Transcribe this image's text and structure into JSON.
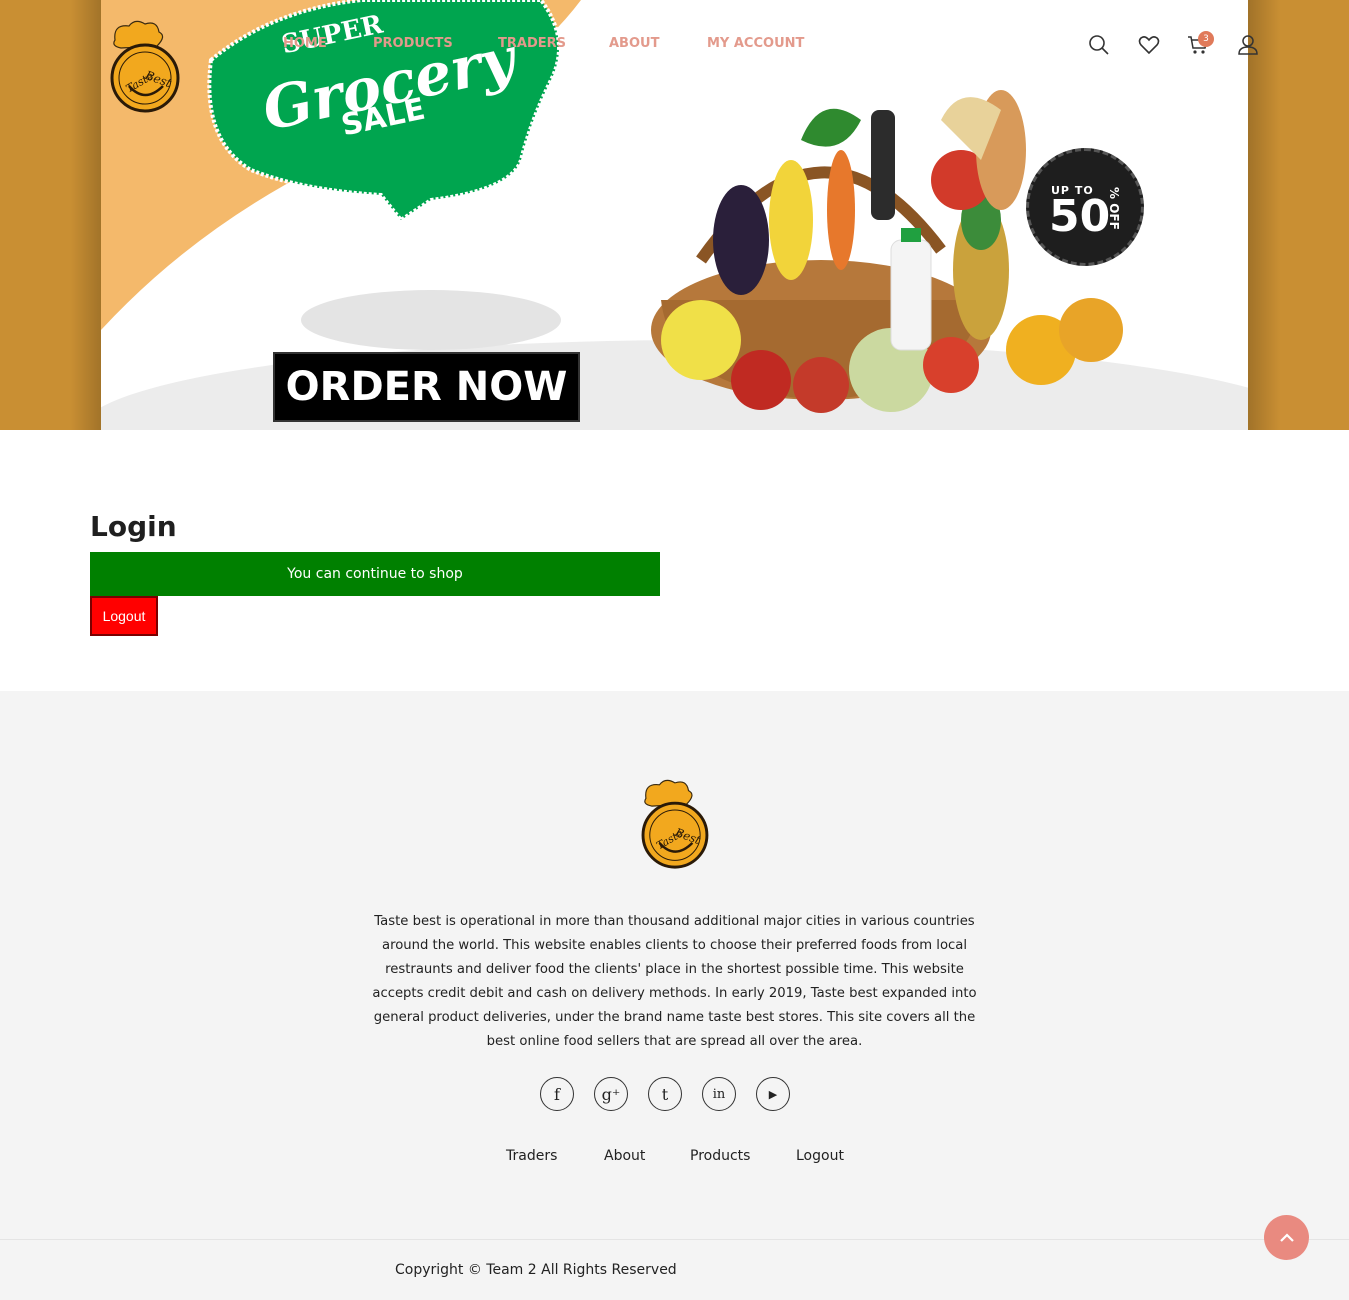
{
  "header": {
    "nav": [
      {
        "label": "HOME"
      },
      {
        "label": "PRODUCTS"
      },
      {
        "label": "TRADERS"
      },
      {
        "label": "ABOUT"
      },
      {
        "label": "MY ACCOUNT"
      }
    ],
    "cart_count": "3",
    "icons": [
      "search-icon",
      "heart-icon",
      "cart-icon",
      "user-icon"
    ]
  },
  "banner": {
    "line1": "SUPER",
    "line2": "Grocery",
    "line3": "SALE",
    "cta": "ORDER NOW",
    "badge_up_to": "UP TO",
    "badge_value": "50",
    "badge_unit": "% OFF"
  },
  "login": {
    "title": "Login",
    "message": "You can continue to shop",
    "logout_label": "Logout"
  },
  "footer": {
    "about": "Taste best is operational in more than thousand additional major cities in various countries around the world. This website enables clients to choose their preferred foods from local restraunts and deliver food the clients' place in the shortest possible time. This website accepts credit debit and cash on delivery methods. In early 2019, Taste best expanded into general product deliveries, under the brand name taste best stores. This site covers all the best online food sellers that are spread all over the area.",
    "socials": [
      {
        "icon": "facebook-icon",
        "glyph": "f"
      },
      {
        "icon": "google-plus-icon",
        "glyph": "g⁺"
      },
      {
        "icon": "tumblr-icon",
        "glyph": "t"
      },
      {
        "icon": "linkedin-icon",
        "glyph": "in"
      },
      {
        "icon": "youtube-icon",
        "glyph": "▶"
      }
    ],
    "links": [
      {
        "label": "Traders"
      },
      {
        "label": "About"
      },
      {
        "label": "Products"
      },
      {
        "label": "Logout"
      }
    ],
    "copyright": "Copyright © Team 2 All Rights Reserved"
  },
  "colors": {
    "accent": "#e39a8c",
    "hero_bg": "#c98f33",
    "success": "#008000",
    "danger": "#ff0000",
    "to_top": "#e98a80"
  }
}
